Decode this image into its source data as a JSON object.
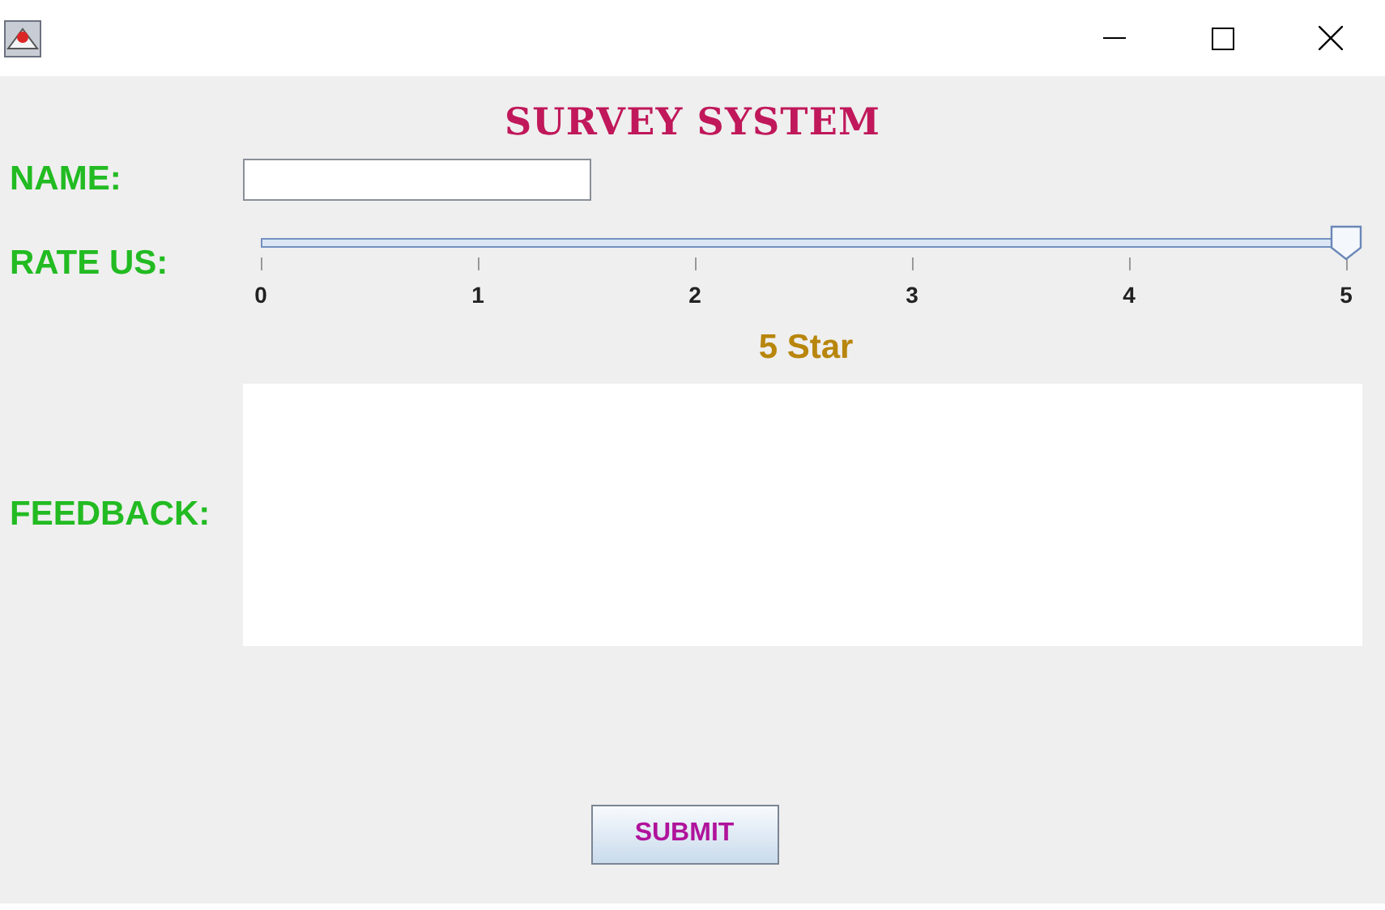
{
  "title": "SURVEY SYSTEM",
  "name_field": {
    "label": "NAME:"
  },
  "rating": {
    "label": "RATE US:",
    "level": 1,
    "ticks": [
      "0",
      "1",
      "2",
      "3",
      "4",
      "5"
    ],
    "reading": "5 Star"
  },
  "feedback": {
    "label": "FEEDBACK:"
  },
  "submit": "SUBMIT"
}
